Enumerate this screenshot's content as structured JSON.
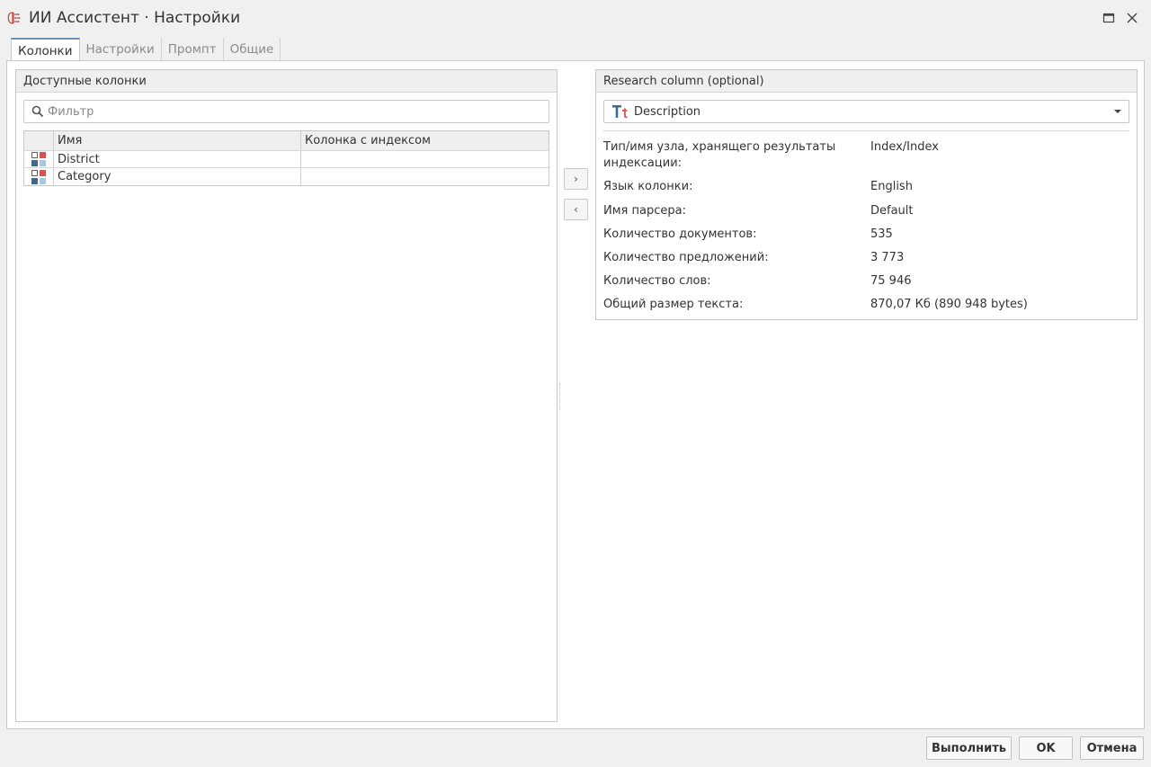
{
  "window": {
    "title": "ИИ Ассистент · Настройки",
    "icon": "brain-icon"
  },
  "tabs": [
    {
      "label": "Колонки",
      "active": true
    },
    {
      "label": "Настройки",
      "active": false
    },
    {
      "label": "Промпт",
      "active": false
    },
    {
      "label": "Общие",
      "active": false
    }
  ],
  "available": {
    "header": "Доступные колонки",
    "filter_placeholder": "Фильтр",
    "columns": {
      "name": "Имя",
      "index_column": "Колонка с индексом"
    },
    "rows": [
      {
        "name": "District",
        "index_column": "",
        "icon": "category-column-icon"
      },
      {
        "name": "Category",
        "index_column": "",
        "icon": "category-column-icon"
      }
    ]
  },
  "move": {
    "right": "›",
    "left": "‹"
  },
  "research": {
    "header": "Research column (optional)",
    "selected": "Description",
    "selected_icon": "text-column-icon",
    "props": [
      {
        "label": "Тип/имя узла, хранящего результаты индексации:",
        "value": "Index/Index"
      },
      {
        "label": "Язык колонки:",
        "value": "English"
      },
      {
        "label": "Имя парсера:",
        "value": "Default"
      },
      {
        "label": "Количество документов:",
        "value": "535"
      },
      {
        "label": "Количество предложений:",
        "value": "3 773"
      },
      {
        "label": "Количество слов:",
        "value": "75 946"
      },
      {
        "label": "Общий размер текста:",
        "value": "870,07 Кб (890 948 bytes)"
      }
    ]
  },
  "footer": {
    "run": "Выполнить",
    "ok": "OK",
    "cancel": "Отмена"
  }
}
